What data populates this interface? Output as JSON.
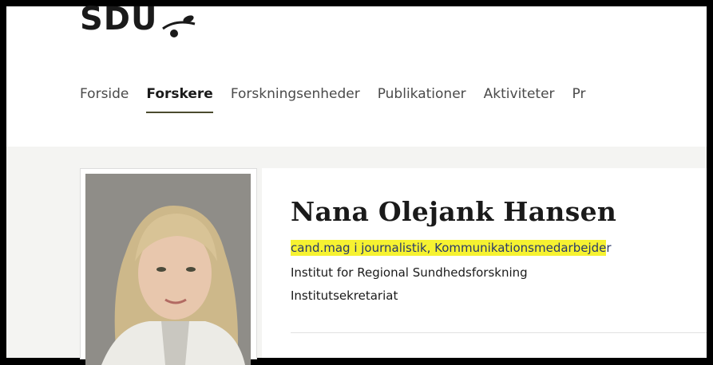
{
  "logo": {
    "text": "SDU"
  },
  "nav": {
    "items": [
      {
        "label": "Forside",
        "active": false
      },
      {
        "label": "Forskere",
        "active": true
      },
      {
        "label": "Forskningsenheder",
        "active": false
      },
      {
        "label": "Publikationer",
        "active": false
      },
      {
        "label": "Aktiviteter",
        "active": false
      },
      {
        "label": "Pr",
        "active": false
      }
    ]
  },
  "profile": {
    "name": "Nana Olejank Hansen",
    "title_highlighted": "cand.mag i journalistik, Kommunikationsmedarbejde",
    "title_rest": "r",
    "institute": "Institut for Regional Sundhedsforskning",
    "unit": "Institutsekretariat"
  },
  "colors": {
    "highlight": "#f6f231",
    "nav_underline": "#4b4b2e"
  }
}
